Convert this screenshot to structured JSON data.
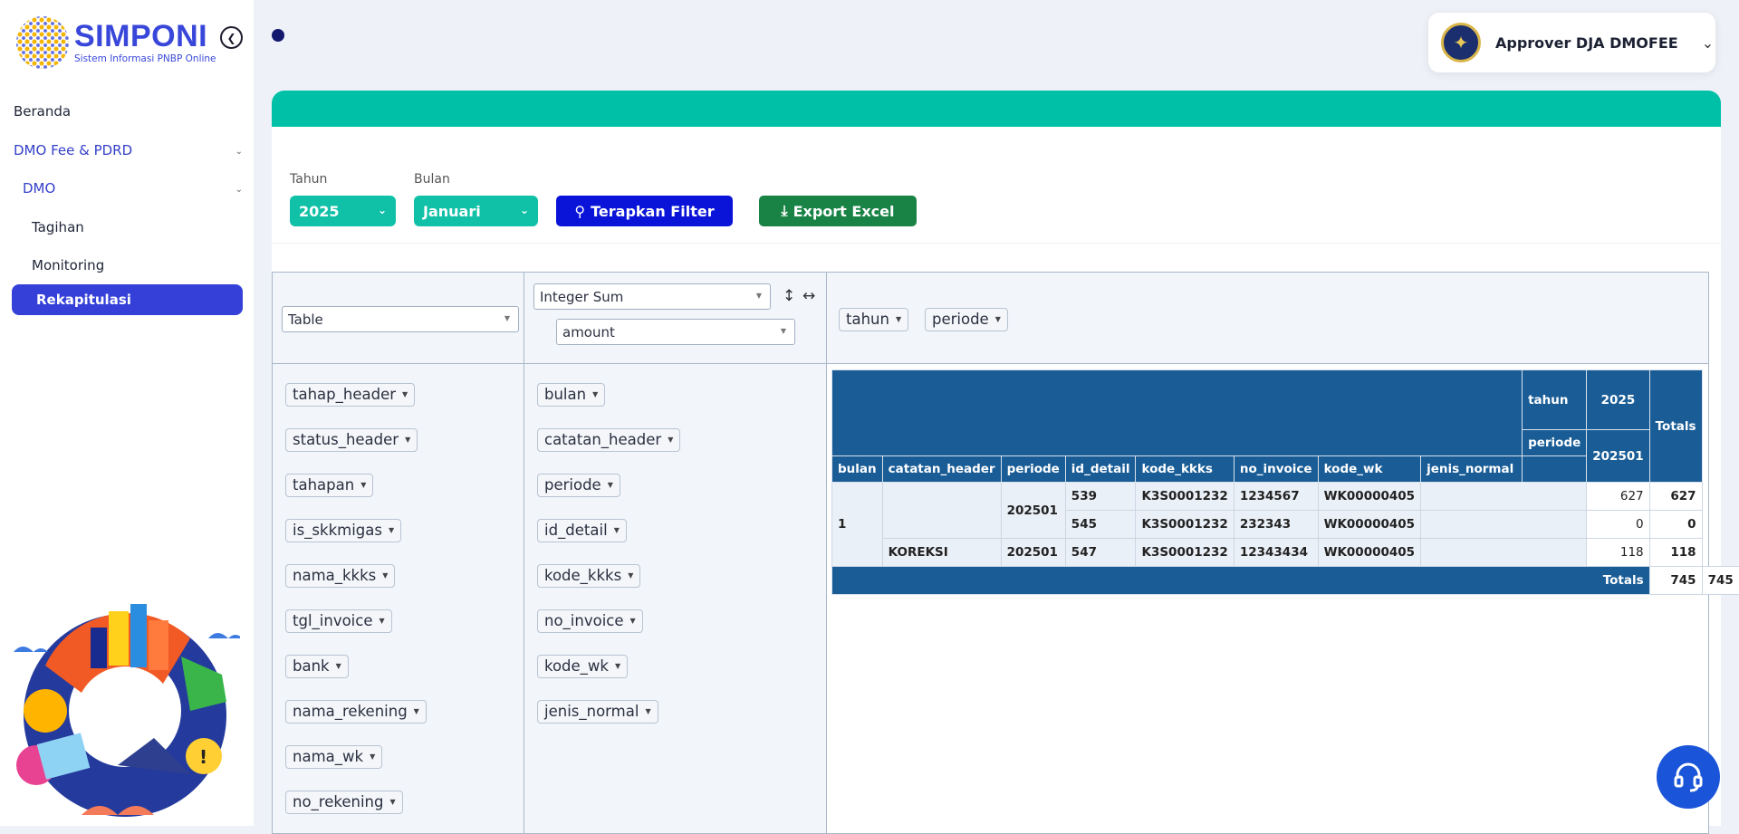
{
  "brand": {
    "title": "SIMPONI",
    "subtitle": "Sistem Informasi PNBP Online"
  },
  "nav": {
    "beranda": "Beranda",
    "dmo_fee": "DMO Fee & PDRD",
    "dmo": "DMO",
    "tagihan": "Tagihan",
    "monitoring": "Monitoring",
    "rekapitulasi": "Rekapitulasi"
  },
  "user": {
    "name": "Approver DJA DMOFEE"
  },
  "filters": {
    "tahun_label": "Tahun",
    "tahun_value": "2025",
    "bulan_label": "Bulan",
    "bulan_value": "Januari",
    "apply_label": "Terapkan Filter",
    "export_label": "Export Excel"
  },
  "pivot": {
    "renderer": "Table",
    "aggregator": "Integer Sum",
    "aggregator_field": "amount",
    "col_attrs": [
      "tahun",
      "periode"
    ],
    "unused_attrs": [
      "tahap_header",
      "status_header",
      "tahapan",
      "is_skkmigas",
      "nama_kkks",
      "tgl_invoice",
      "bank",
      "nama_rekening",
      "nama_wk",
      "no_rekening"
    ],
    "row_attrs": [
      "bulan",
      "catatan_header",
      "periode",
      "id_detail",
      "kode_kkks",
      "no_invoice",
      "kode_wk",
      "jenis_normal"
    ]
  },
  "table": {
    "col_header_tahun": "tahun",
    "col_header_periode": "periode",
    "tahun_value": "2025",
    "periode_value": "202501",
    "totals_label": "Totals",
    "row_headers": [
      "bulan",
      "catatan_header",
      "periode",
      "id_detail",
      "kode_kkks",
      "no_invoice",
      "kode_wk",
      "jenis_normal"
    ],
    "rows": [
      {
        "bulan": "1",
        "catatan": "",
        "periode": "202501",
        "id": "539",
        "kkks": "K3S0001232",
        "inv": "1234567",
        "wk": "WK00000405",
        "jenis": "",
        "val": "627",
        "tot": "627"
      },
      {
        "id": "545",
        "kkks": "K3S0001232",
        "inv": "232343",
        "wk": "WK00000405",
        "jenis": "",
        "val": "0",
        "tot": "0"
      },
      {
        "catatan": "KOREKSI",
        "periode": "202501",
        "id": "547",
        "kkks": "K3S0001232",
        "inv": "12343434",
        "wk": "WK00000405",
        "jenis": "",
        "val": "118",
        "tot": "118"
      }
    ],
    "grand_total_col": "745",
    "grand_total": "745"
  }
}
